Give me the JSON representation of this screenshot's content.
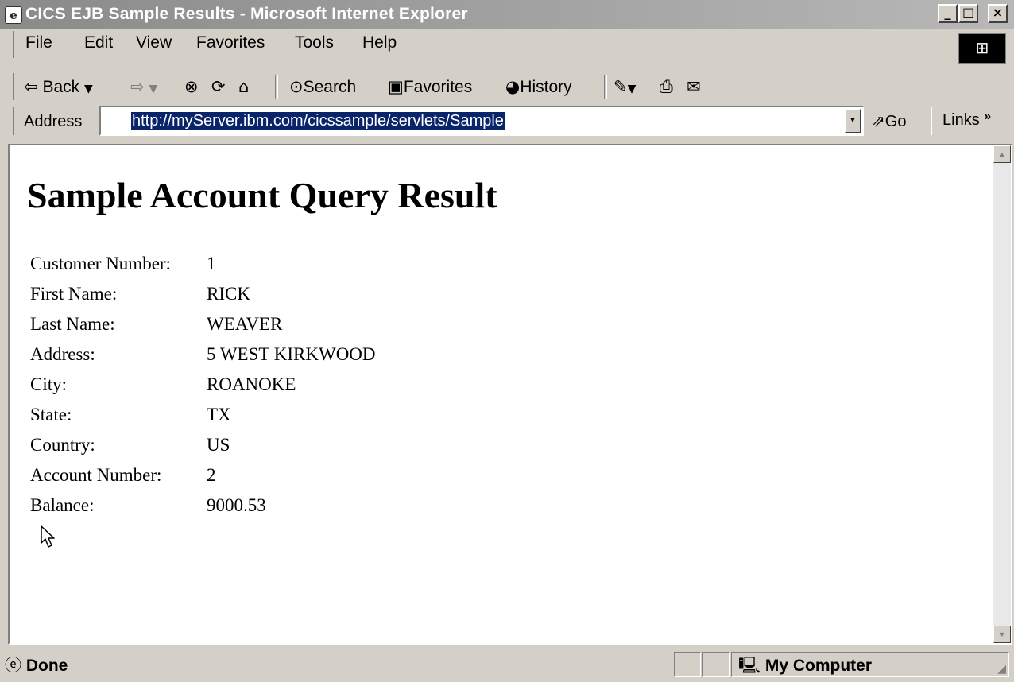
{
  "window": {
    "title": "CICS EJB Sample Results - Microsoft Internet Explorer",
    "app_icon": "ie-page-icon",
    "controls": {
      "minimize": "_",
      "maximize": "□",
      "close": "×"
    }
  },
  "menu": {
    "items": [
      {
        "label": "File"
      },
      {
        "label": "Edit"
      },
      {
        "label": "View"
      },
      {
        "label": "Favorites"
      },
      {
        "label": "Tools"
      },
      {
        "label": "Help"
      }
    ]
  },
  "toolbar": {
    "back_label": "Back",
    "search_label": "Search",
    "favorites_label": "Favorites",
    "history_label": "History",
    "icons": [
      "back-arrow-icon",
      "forward-arrow-icon",
      "stop-icon",
      "refresh-icon",
      "home-icon",
      "search-icon",
      "favorites-icon",
      "history-icon",
      "edit-icon",
      "print-icon",
      "discuss-icon"
    ]
  },
  "address_bar": {
    "label": "Address",
    "url": "http://myServer.ibm.com/cicssample/servlets/Sample",
    "go_label": "Go",
    "links_label": "Links",
    "links_chevron": "»"
  },
  "page": {
    "heading": "Sample Account Query Result",
    "fields": [
      {
        "label": "Customer Number:",
        "value": "1"
      },
      {
        "label": "First Name:",
        "value": "RICK"
      },
      {
        "label": "Last Name:",
        "value": "WEAVER"
      },
      {
        "label": "Address:",
        "value": "5 WEST KIRKWOOD"
      },
      {
        "label": "City:",
        "value": "ROANOKE"
      },
      {
        "label": "State:",
        "value": "TX"
      },
      {
        "label": "Country:",
        "value": "US"
      },
      {
        "label": "Account Number:",
        "value": "2"
      },
      {
        "label": "Balance:",
        "value": "9000.53"
      }
    ]
  },
  "status_bar": {
    "status": "Done",
    "zone": "My Computer"
  },
  "colors": {
    "titlebar_start": "#8a8a8a",
    "chrome": "#d4d0c8",
    "url_highlight": "#0a246a"
  }
}
